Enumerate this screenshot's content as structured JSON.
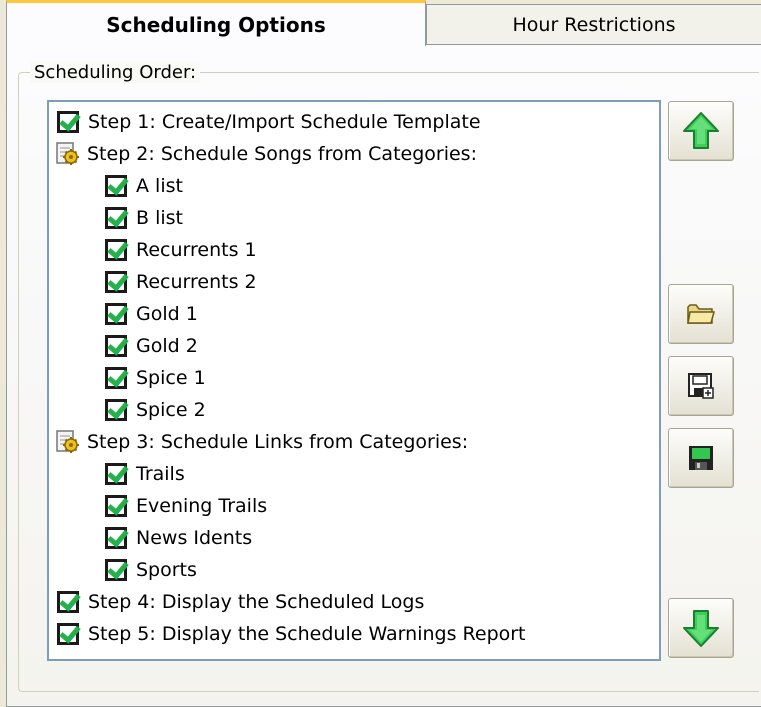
{
  "tabs": {
    "active_label": "Scheduling Options",
    "inactive_label": "Hour Restrictions"
  },
  "group_label": "Scheduling Order:",
  "tree": {
    "step1": "Step 1: Create/Import Schedule Template",
    "step2": "Step 2: Schedule Songs from Categories:",
    "songs": [
      "A list",
      "B list",
      "Recurrents 1",
      "Recurrents 2",
      "Gold 1",
      "Gold 2",
      "Spice 1",
      "Spice 2"
    ],
    "step3": "Step 3: Schedule Links from Categories:",
    "links": [
      "Trails",
      "Evening Trails",
      "News Idents",
      "Sports"
    ],
    "step4": "Step 4: Display the Scheduled Logs",
    "step5": "Step 5: Display the Schedule Warnings Report"
  },
  "icons": {
    "move_up": "up-arrow-icon",
    "open": "folder-icon",
    "save_as": "save-as-icon",
    "save": "save-icon",
    "move_down": "down-arrow-icon"
  },
  "colors": {
    "check": "#22b14c",
    "arrow": "#22b14c",
    "tab_highlight": "#ffc83c"
  }
}
